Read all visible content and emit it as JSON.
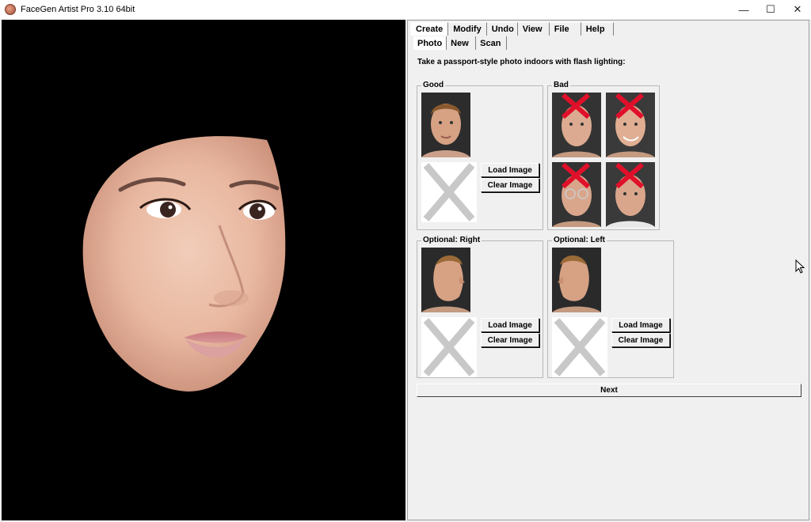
{
  "window": {
    "title": "FaceGen Artist Pro 3.10 64bit",
    "minimize": "—",
    "maximize": "☐",
    "close": "✕"
  },
  "menu": {
    "tabs": [
      "Create",
      "Modify",
      "Undo",
      "View",
      "File",
      "Help"
    ],
    "active": "Create"
  },
  "subtabs": {
    "items": [
      "Photo",
      "New",
      "Scan"
    ],
    "active": "Photo"
  },
  "instruction": "Take a passport-style photo indoors with flash lighting:",
  "groups": {
    "good": {
      "label": "Good"
    },
    "bad": {
      "label": "Bad"
    },
    "right": {
      "label": "Optional: Right"
    },
    "left": {
      "label": "Optional: Left"
    }
  },
  "buttons": {
    "load": "Load Image",
    "clear": "Clear Image",
    "next": "Next"
  },
  "colors": {
    "x_mark": "#e0102a",
    "placeholder_x": "#c8c8c8",
    "viewport_bg": "#000000",
    "panel_bg": "#f0f0f0"
  }
}
